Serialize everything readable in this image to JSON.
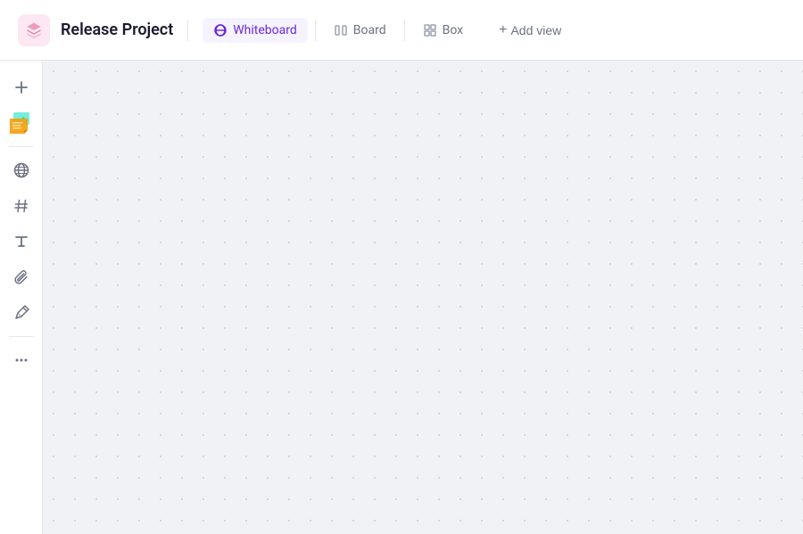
{
  "header": {
    "project_title": "Release Project",
    "tabs": [
      {
        "id": "whiteboard",
        "label": "Whiteboard",
        "active": true
      },
      {
        "id": "board",
        "label": "Board",
        "active": false
      },
      {
        "id": "box",
        "label": "Box",
        "active": false
      }
    ],
    "add_view_label": "Add view"
  },
  "toolbar": {
    "buttons": [
      {
        "id": "add",
        "icon": "+",
        "label": "Add"
      },
      {
        "id": "globe",
        "icon": "globe",
        "label": "Globe"
      },
      {
        "id": "hash",
        "icon": "#",
        "label": "Hash"
      },
      {
        "id": "text",
        "icon": "T",
        "label": "Text"
      },
      {
        "id": "attach",
        "icon": "attach",
        "label": "Attach"
      },
      {
        "id": "draw",
        "icon": "draw",
        "label": "Draw"
      },
      {
        "id": "more",
        "icon": "...",
        "label": "More"
      }
    ]
  },
  "canvas": {
    "background_color": "#f0f2f5",
    "dot_color": "#c8cdd6"
  }
}
